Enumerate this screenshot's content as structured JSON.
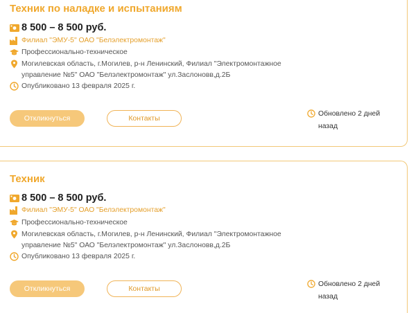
{
  "vacancies": [
    {
      "title": "Техник по наладке и испытаниям",
      "salary": "8 500 – 8 500 руб.",
      "company": "Филиал \"ЭМУ-5\" ОАО \"Белэлектромонтаж\"",
      "education": "Профессионально-техническое",
      "address_line1": "Могилевская область, г.Могилев, р-н Ленинский, Филиал \"Электромонтажное",
      "address_line2": "управление №5\" ОАО \"Белэлектромонтаж\" ул.Заслоновв,д.2Б",
      "published": "Опубликовано 13 февраля 2025 г.",
      "apply_label": "Откликнуться",
      "contacts_label": "Контакты",
      "updated": "Обновлено 2 дней назад"
    },
    {
      "title": "Техник",
      "salary": "8 500 – 8 500 руб.",
      "company": "Филиал \"ЭМУ-5\" ОАО \"Белэлектромонтаж\"",
      "education": "Профессионально-техническое",
      "address_line1": "Могилевская область, г.Могилев, р-н Ленинский, Филиал \"Электромонтажное",
      "address_line2": "управление №5\" ОАО \"Белэлектромонтаж\" ул.Заслоновв,д.2Б",
      "published": "Опубликовано 13 февраля 2025 г.",
      "apply_label": "Откликнуться",
      "contacts_label": "Контакты",
      "updated": "Обновлено 2 дней назад"
    }
  ],
  "icons": {
    "salary": "money-icon",
    "company": "factory-icon",
    "education": "graduation-cap-icon",
    "address": "location-pin-icon",
    "published": "clock-icon",
    "updated": "clock-icon"
  },
  "colors": {
    "accent": "#f0a82d",
    "button_fill": "#f6c87a",
    "border": "#f2c877"
  }
}
